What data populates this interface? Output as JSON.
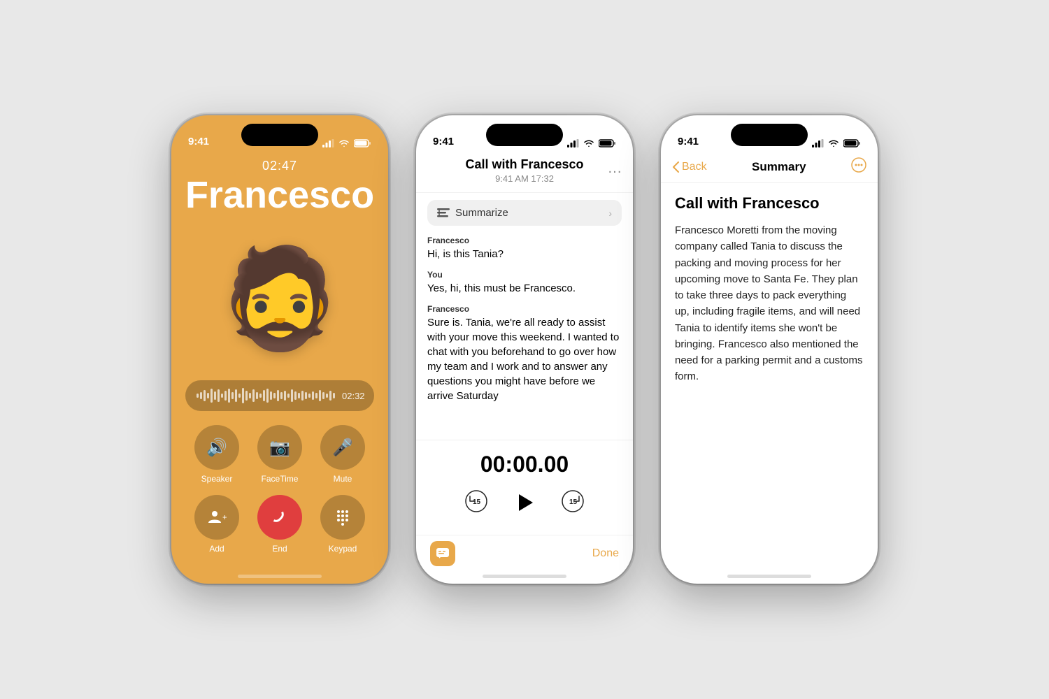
{
  "phone1": {
    "status": {
      "time": "9:41",
      "signal": "signal",
      "wifi": "wifi",
      "battery": "battery"
    },
    "call_timer": "02:47",
    "caller_name": "Francesco",
    "record_timer": "02:32",
    "info_icon": "ⓘ",
    "buttons": [
      {
        "icon": "🔊",
        "label": "Speaker"
      },
      {
        "icon": "📷",
        "label": "FaceTime"
      },
      {
        "icon": "🎤",
        "label": "Mute"
      }
    ],
    "buttons2": [
      {
        "icon": "👤",
        "label": "Add"
      },
      {
        "icon": "📞",
        "label": "End",
        "type": "end"
      },
      {
        "icon": "⌨",
        "label": "Keypad"
      }
    ]
  },
  "phone2": {
    "status": {
      "time": "9:41"
    },
    "title": "Call with Francesco",
    "subtitle": "9:41 AM  17:32",
    "summarize_label": "Summarize",
    "messages": [
      {
        "sender": "Francesco",
        "text": "Hi, is this Tania?"
      },
      {
        "sender": "You",
        "text": "Yes, hi, this must be Francesco."
      },
      {
        "sender": "Francesco",
        "text": "Sure is. Tania, we're all ready to assist with your move this weekend. I wanted to chat with you beforehand to go over how my team and I work and to answer any questions you might have before we arrive Saturday"
      }
    ],
    "playback_timer": "00:00.00",
    "done_label": "Done"
  },
  "phone3": {
    "status": {
      "time": "9:41"
    },
    "back_label": "Back",
    "nav_title": "Summary",
    "title": "Call with Francesco",
    "summary_text": "Francesco Moretti from the moving company called Tania to discuss the packing and moving process for her upcoming move to Santa Fe. They plan to take three days to pack everything up, including fragile items, and will need Tania to identify items she won't be bringing. Francesco also mentioned the need for a parking permit and a customs form."
  }
}
